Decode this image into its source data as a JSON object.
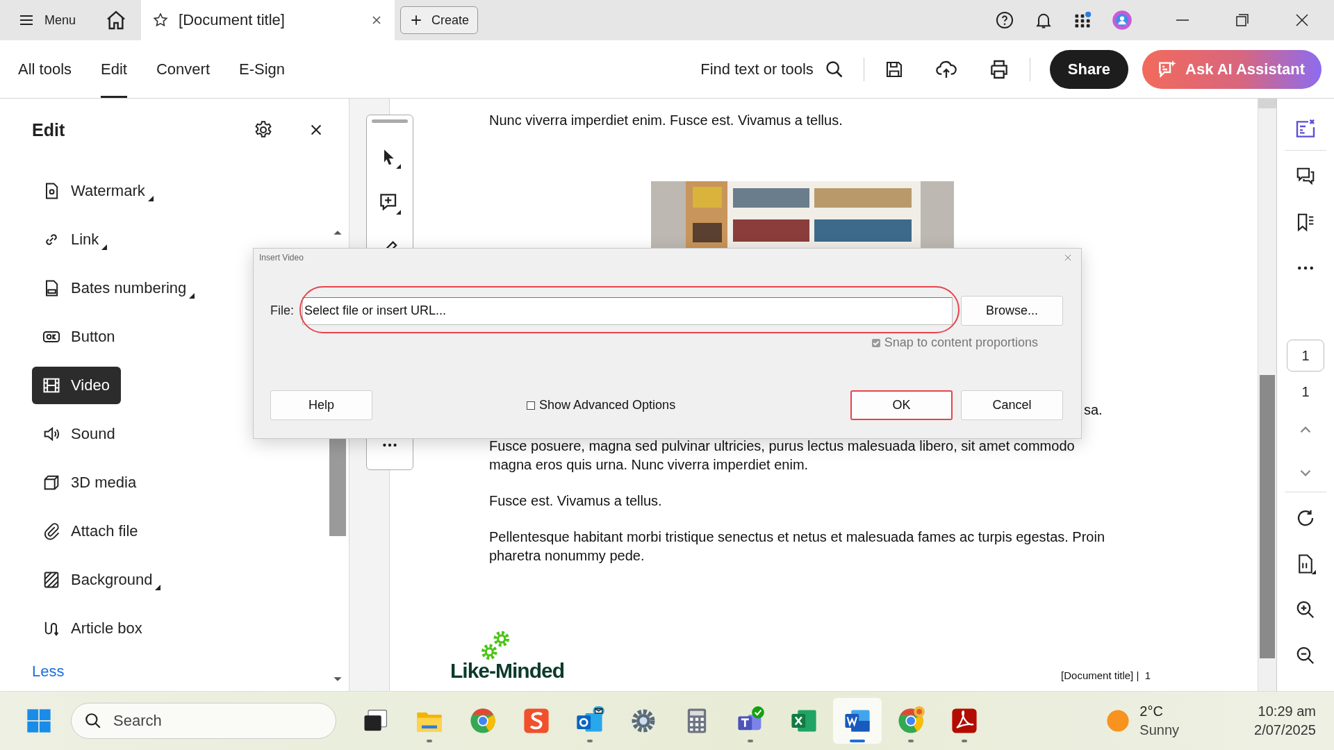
{
  "tab_bar": {
    "menu_label": "Menu",
    "document_tab": {
      "title": "[Document title]"
    },
    "create_button": "Create"
  },
  "toolbar": {
    "tabs": [
      {
        "label": "All tools",
        "selected": false
      },
      {
        "label": "Edit",
        "selected": true
      },
      {
        "label": "Convert",
        "selected": false
      },
      {
        "label": "E-Sign",
        "selected": false
      }
    ],
    "find_button": "Find text or tools",
    "share_button": "Share",
    "ai_button": "Ask AI Assistant"
  },
  "edit_panel": {
    "title": "Edit",
    "items": [
      {
        "kind": "watermark",
        "label": "Watermark",
        "has_submenu": true,
        "selected": false
      },
      {
        "kind": "link",
        "label": "Link",
        "has_submenu": true,
        "selected": false
      },
      {
        "kind": "bates",
        "label": "Bates numbering",
        "has_submenu": true,
        "selected": false
      },
      {
        "kind": "button",
        "label": "Button",
        "has_submenu": false,
        "selected": false
      },
      {
        "kind": "video",
        "label": "Video",
        "has_submenu": false,
        "selected": true
      },
      {
        "kind": "sound",
        "label": "Sound",
        "has_submenu": false,
        "selected": false
      },
      {
        "kind": "cube",
        "label": "3D media",
        "has_submenu": false,
        "selected": false
      },
      {
        "kind": "attach",
        "label": "Attach file",
        "has_submenu": false,
        "selected": false
      },
      {
        "kind": "background",
        "label": "Background",
        "has_submenu": true,
        "selected": false
      },
      {
        "kind": "article",
        "label": "Article box",
        "has_submenu": false,
        "selected": false
      }
    ],
    "less_link": "Less"
  },
  "document": {
    "first_line": "Nunc viverra imperdiet enim. Fusce est. Vivamus a tellus.",
    "image": {
      "kind": "picture"
    },
    "partial_line": "sa.",
    "paragraphs": [
      "Fusce posuere, magna sed pulvinar ultricies, purus lectus malesuada libero, sit amet commodo magna eros quis urna. Nunc viverra imperdiet enim.",
      "Fusce est. Vivamus a tellus.",
      "Pellentesque habitant morbi tristique senectus et netus et malesuada fames ac turpis egestas. Proin pharetra nonummy pede."
    ],
    "logo_text": "Like-Minded",
    "footer": "[Document title] |  1"
  },
  "dialog": {
    "title": "Insert Video",
    "file_label": "File:",
    "file_field": {
      "value": "Select file or insert URL...",
      "highlighted": true
    },
    "browse_button": "Browse...",
    "snap": {
      "label": "Snap to content proportions",
      "checked": true,
      "disabled": true
    },
    "advanced": {
      "label": "Show Advanced Options",
      "checked": false
    },
    "buttons": [
      {
        "kind": "help",
        "label": "Help",
        "highlighted": false
      },
      {
        "kind": "ok",
        "label": "OK",
        "highlighted": true
      },
      {
        "kind": "cancel",
        "label": "Cancel",
        "highlighted": false
      }
    ]
  },
  "page_nav": {
    "current": "1",
    "total": "1"
  },
  "taskbar": {
    "search": {
      "placeholder": "Search"
    },
    "apps": [
      {
        "kind": "taskview",
        "running": false,
        "active": false
      },
      {
        "kind": "files",
        "running": true,
        "active": false
      },
      {
        "kind": "chrome",
        "running": false,
        "active": false
      },
      {
        "kind": "snagit",
        "running": false,
        "active": false
      },
      {
        "kind": "outlook",
        "running": true,
        "active": false
      },
      {
        "kind": "settings",
        "running": false,
        "active": false
      },
      {
        "kind": "calculator",
        "running": false,
        "active": false
      },
      {
        "kind": "teams",
        "running": true,
        "active": false
      },
      {
        "kind": "excel",
        "running": false,
        "active": false
      },
      {
        "kind": "word",
        "running": true,
        "active": true
      },
      {
        "kind": "chrome2",
        "running": true,
        "active": false
      },
      {
        "kind": "acrobat",
        "running": true,
        "active": false
      }
    ],
    "weather": {
      "temperature": "2°C",
      "condition": "Sunny"
    },
    "clock": {
      "time": "10:29 am",
      "date": "2/07/2025"
    }
  }
}
